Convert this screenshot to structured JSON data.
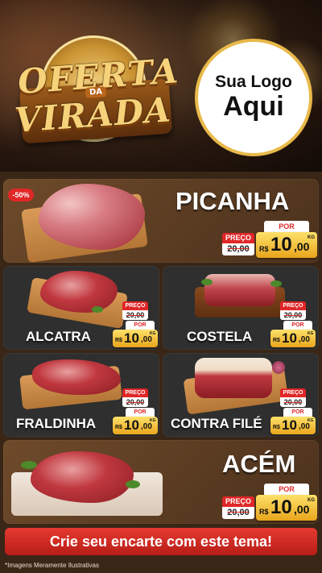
{
  "header": {
    "campaign_line1": "OFERTA",
    "campaign_da": "DA",
    "campaign_line2": "VIRADA",
    "logo_line1": "Sua Logo",
    "logo_line2": "Aqui"
  },
  "discount_badge": "-50%",
  "labels": {
    "preco": "PREÇO",
    "por": "POR",
    "currency": "R$",
    "unit": "KG"
  },
  "products": {
    "picanha": {
      "name": "PICANHA",
      "old_price": "20,00",
      "new_price_int": "10",
      "new_price_dec": ",00"
    },
    "alcatra": {
      "name": "ALCATRA",
      "old_price": "20,00",
      "new_price_int": "10",
      "new_price_dec": ",00"
    },
    "costela": {
      "name": "COSTELA",
      "old_price": "20,00",
      "new_price_int": "10",
      "new_price_dec": ",00"
    },
    "fraldinha": {
      "name": "FRALDINHA",
      "old_price": "20,00",
      "new_price_int": "10",
      "new_price_dec": ",00"
    },
    "contrafile": {
      "name": "CONTRA FILÉ",
      "old_price": "20,00",
      "new_price_int": "10",
      "new_price_dec": ",00"
    },
    "acem": {
      "name": "ACÉM",
      "old_price": "20,00",
      "new_price_int": "10",
      "new_price_dec": ",00"
    }
  },
  "cta": "Crie seu encarte com este tema!",
  "note": "*Imagens Meramente Ilustrativas",
  "colors": {
    "accent_red": "#e02727",
    "gold": "#e9a51b",
    "brown_bg": "#3a2616"
  }
}
